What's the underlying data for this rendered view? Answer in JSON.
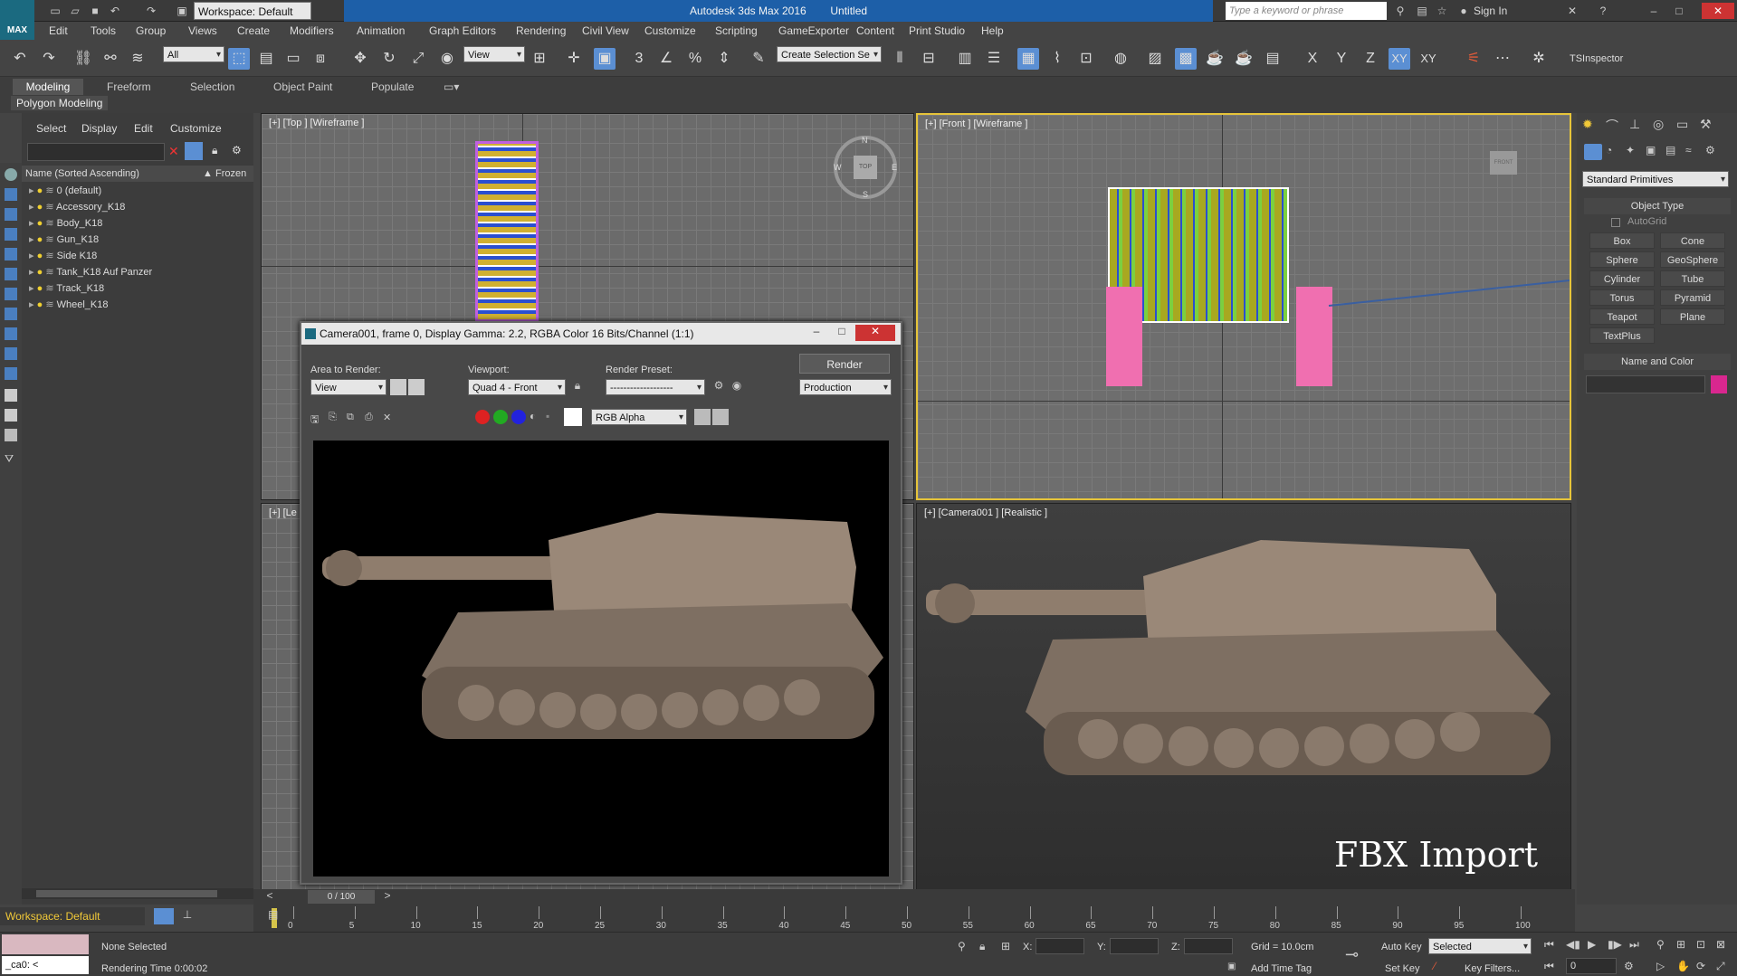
{
  "app": {
    "title": "Autodesk 3ds Max 2016",
    "document": "Untitled",
    "logo": "MAX"
  },
  "quick_access": {
    "workspace": "Workspace: Default"
  },
  "search": {
    "placeholder": "Type a keyword or phrase"
  },
  "account": {
    "sign_in": "Sign In"
  },
  "menu": [
    "Edit",
    "Tools",
    "Group",
    "Views",
    "Create",
    "Modifiers",
    "Animation",
    "Graph Editors",
    "Rendering",
    "Civil View",
    "Customize",
    "Scripting",
    "GameExporter",
    "Content",
    "Print Studio",
    "Help"
  ],
  "toolbar": {
    "selection_filter": "All",
    "ref_coord": "View",
    "named_selection": "Create Selection Se",
    "axes": [
      "X",
      "Y",
      "Z",
      "XY",
      "XY"
    ],
    "inspector": "TSInspector"
  },
  "ribbon": {
    "tabs": [
      "Modeling",
      "Freeform",
      "Selection",
      "Object Paint",
      "Populate"
    ],
    "panel": "Polygon Modeling"
  },
  "scene_explorer": {
    "menus": [
      "Select",
      "Display",
      "Edit",
      "Customize"
    ],
    "col_name": "Name (Sorted Ascending)",
    "col_frozen": "Frozen",
    "layers": [
      "0 (default)",
      "Accessory_K18",
      "Body_K18",
      "Gun_K18",
      "Side K18",
      "Tank_K18 Auf Panzer",
      "Track_K18",
      "Wheel_K18"
    ],
    "workspace": "Workspace: Default"
  },
  "viewports": {
    "top": "[+] [Top ] [Wireframe ]",
    "front": "[+] [Front ] [Wireframe ]",
    "left": "[+] [Le",
    "camera": "[+] [Camera001 ] [Realistic ]",
    "overlay": "FBX Import",
    "viewcube_top": "TOP",
    "viewcube_front": "FRONT",
    "compass": [
      "N",
      "W",
      "E",
      "S"
    ]
  },
  "render_window": {
    "title": "Camera001, frame 0, Display Gamma: 2.2, RGBA Color 16 Bits/Channel (1:1)",
    "area_label": "Area to Render:",
    "area_value": "View",
    "viewport_label": "Viewport:",
    "viewport_value": "Quad 4 - Front",
    "preset_label": "Render Preset:",
    "preset_value": "-------------------",
    "render_button": "Render",
    "production": "Production",
    "channel": "RGB Alpha"
  },
  "command_panel": {
    "category": "Standard Primitives",
    "object_type": "Object Type",
    "autogrid": "AutoGrid",
    "buttons": [
      "Box",
      "Cone",
      "Sphere",
      "GeoSphere",
      "Cylinder",
      "Tube",
      "Torus",
      "Pyramid",
      "Teapot",
      "Plane",
      "TextPlus"
    ],
    "name_and_color": "Name and Color",
    "swatch_color": "#d9278f"
  },
  "timeline": {
    "frame": "0 / 100",
    "ticks": [
      "0",
      "5",
      "10",
      "15",
      "20",
      "25",
      "30",
      "35",
      "40",
      "45",
      "50",
      "55",
      "60",
      "65",
      "70",
      "75",
      "80",
      "85",
      "90",
      "95",
      "100"
    ]
  },
  "status": {
    "selection": "None Selected",
    "render_time": "Rendering Time  0:00:02",
    "maxscript": "_ca0: <",
    "x_label": "X:",
    "y_label": "Y:",
    "z_label": "Z:",
    "grid": "Grid = 10.0cm",
    "add_time_tag": "Add Time Tag",
    "auto_key": "Auto Key",
    "set_key": "Set Key",
    "selected": "Selected",
    "key_filters": "Key Filters...",
    "frame_field": "0"
  }
}
